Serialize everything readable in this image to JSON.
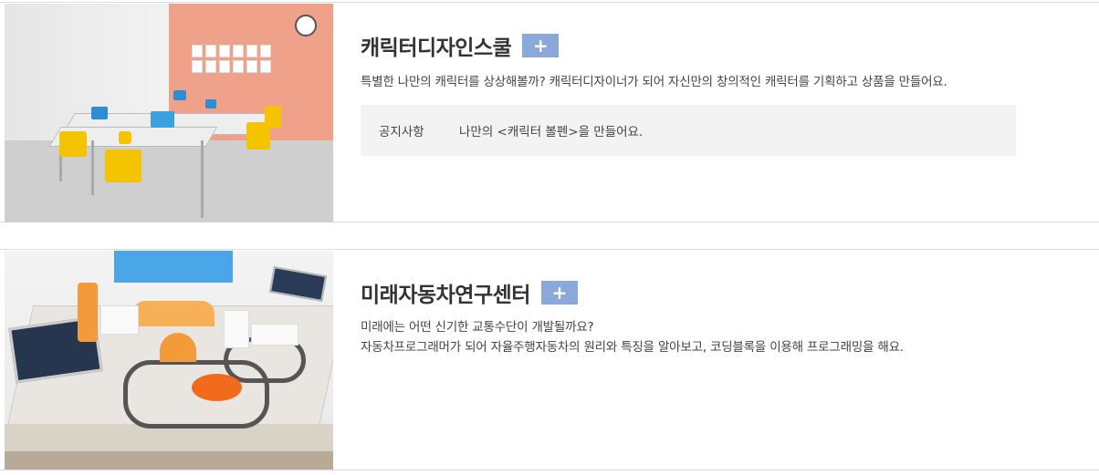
{
  "programs": [
    {
      "title": "캐릭터디자인스쿨",
      "plus_label": "+",
      "description": "특별한 나만의 캐릭터를 상상해볼까? 캐릭터디자이너가 되어 자신만의 창의적인 캐릭터를 기획하고 상품을 만들어요.",
      "notice_label": "공지사항",
      "notice_text": "나만의 <캐릭터 볼펜>을 만들어요."
    },
    {
      "title": "미래자동차연구센터",
      "plus_label": "+",
      "description_line1": "미래에는 어떤 신기한 교통수단이 개발될까요?",
      "description_line2": "자동차프로그래머가 되어 자율주행자동차의 원리와 특징을 알아보고, 코딩블록을 이용해 프로그래밍을 해요."
    }
  ],
  "colors": {
    "plus_button": "#8aa8d8",
    "notice_bg": "#f3f3f3",
    "classroom_wall": "#efa18a",
    "chair": "#f5c400"
  }
}
